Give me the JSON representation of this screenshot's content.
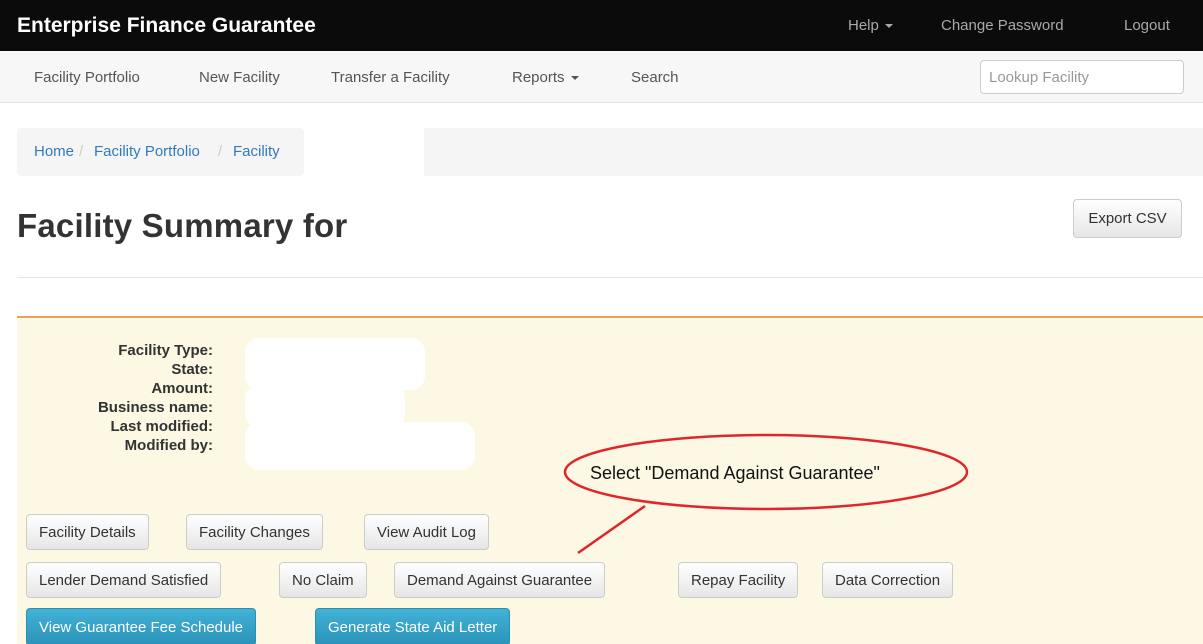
{
  "topbar": {
    "brand": "Enterprise Finance Guarantee",
    "help": "Help",
    "change_password": "Change Password",
    "logout": "Logout"
  },
  "subnav": {
    "facility_portfolio": "Facility Portfolio",
    "new_facility": "New Facility",
    "transfer_facility": "Transfer a Facility",
    "reports": "Reports",
    "search": "Search",
    "lookup_placeholder": "Lookup Facility"
  },
  "breadcrumb": {
    "home": "Home",
    "facility_portfolio": "Facility Portfolio",
    "facility": "Facility",
    "separator": "/"
  },
  "page": {
    "title": "Facility Summary for",
    "export_csv": "Export CSV"
  },
  "summary": {
    "labels": [
      "Facility Type:",
      "State:",
      "Amount:",
      "Business name:",
      "Last modified:",
      "Modified by:"
    ]
  },
  "actions": {
    "row1": [
      "Facility Details",
      "Facility Changes",
      "View Audit Log"
    ],
    "row2": [
      "Lender Demand Satisfied",
      "No Claim",
      "Demand Against Guarantee",
      "Repay Facility",
      "Data Correction"
    ],
    "row3": [
      "View Guarantee Fee Schedule",
      "Generate State Aid Letter"
    ]
  },
  "annotation": {
    "text": "Select \"Demand Against Guarantee\"",
    "color": "#e0262c"
  }
}
